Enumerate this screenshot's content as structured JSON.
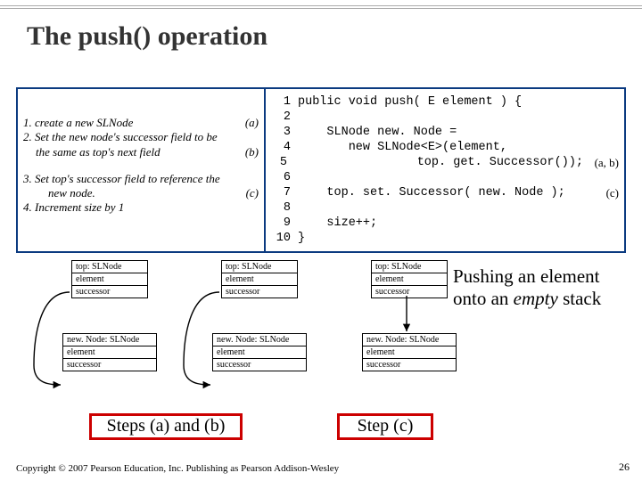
{
  "title": "The push() operation",
  "steps": {
    "s1": {
      "text": "1. create a new SLNode",
      "tag": "(a)"
    },
    "s2a": {
      "text": "2. Set the new node's successor field to be"
    },
    "s2b": {
      "text": "the same as top's next field",
      "tag": "(b)"
    },
    "s3a": {
      "text": "3. Set top's successor field to reference the"
    },
    "s3b": {
      "text": "new node.",
      "tag": "(c)"
    },
    "s4": {
      "text": "4. Increment size by 1"
    }
  },
  "code": {
    "l1": "public void push( E element ) {",
    "l2": "",
    "l3": "    SLNode new. Node =",
    "l4": "       new SLNode<E>(element,",
    "l5": "                 top. get. Successor());",
    "a5": "(a, b)",
    "l6": "",
    "l7": "    top. set. Successor( new. Node );",
    "a7": "(c)",
    "l8": "",
    "l9": "    size++;",
    "l10": "}"
  },
  "node_labels": {
    "top": "top: SLNode",
    "newn": "new. Node: SLNode",
    "element": "element",
    "successor": "successor"
  },
  "captions": {
    "ab": "Steps (a) and (b)",
    "c": "Step (c)",
    "side1": "Pushing an element",
    "side2": "onto an ",
    "side_em": "empty",
    "side3": " stack"
  },
  "footer": "Copyright © 2007 Pearson Education, Inc. Publishing as Pearson Addison-Wesley",
  "pagenum": "26"
}
